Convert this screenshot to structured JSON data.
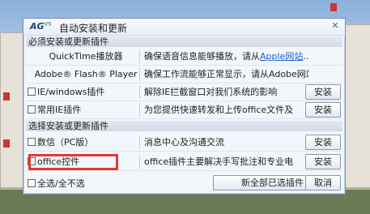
{
  "dialog": {
    "logo_text": "AG",
    "logo_sup": "V5",
    "title": "自动安装和更新",
    "close_glyph": "✕"
  },
  "sections": {
    "required": "必须安装或更新插件",
    "optional": "选择安装或更新插件"
  },
  "required_items": [
    {
      "name": "QuickTime播放器",
      "desc_prefix": "确保语音信息能够播放，请从",
      "desc_link": "Apple网站",
      "desc_suffix": "..."
    },
    {
      "name": "Adobe® Flash® Player",
      "desc": "确保工作流能够正常显示，请从Adobe网站</..."
    },
    {
      "name": "IE/windows插件",
      "desc": "解除IE拦截窗口对我们系统的影响",
      "button": "安装"
    },
    {
      "name": "常用IE插件",
      "desc": "为您提供快速转发和上传office文件及",
      "button": "安装"
    }
  ],
  "optional_items": [
    {
      "name": "数信（PC版）",
      "desc": "消息中心及沟通交流",
      "button": "安装"
    },
    {
      "name": "office控件",
      "desc": "office插件主要解决手写批注和专业电",
      "button": "安装"
    }
  ],
  "footer": {
    "select_all": "全选/全不选",
    "install_all": "新全部已选插件",
    "cancel": "取消"
  }
}
